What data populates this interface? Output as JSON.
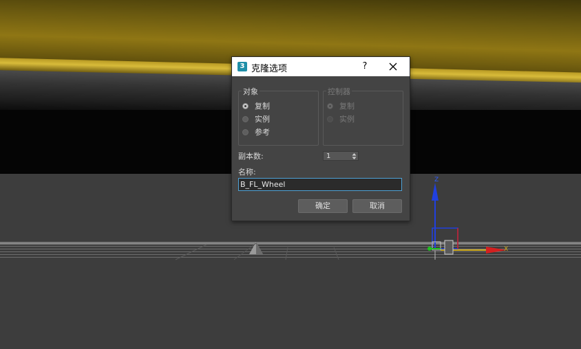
{
  "dialog": {
    "icon_glyph": "3",
    "title": "克隆选项",
    "help_label": "?",
    "object_group": {
      "legend": "对象",
      "options": [
        {
          "label": "复制",
          "checked": true
        },
        {
          "label": "实例",
          "checked": false
        },
        {
          "label": "参考",
          "checked": false
        }
      ]
    },
    "controller_group": {
      "legend": "控制器",
      "disabled": true,
      "options": [
        {
          "label": "复制",
          "checked": true
        },
        {
          "label": "实例",
          "checked": false
        }
      ]
    },
    "copies_label": "副本数:",
    "copies_value": "1",
    "name_label": "名称:",
    "name_value": "B_FL_Wheel",
    "ok_label": "确定",
    "cancel_label": "取消"
  },
  "viewport": {
    "gizmo_labels": {
      "z": "Z",
      "x": "X"
    },
    "colors": {
      "car_paint": "#8f7614",
      "axis_x": "#d42020",
      "axis_y": "#20c020",
      "axis_z": "#2040e0",
      "dialog_bg": "#444444",
      "input_border": "#4fa3d8"
    }
  }
}
